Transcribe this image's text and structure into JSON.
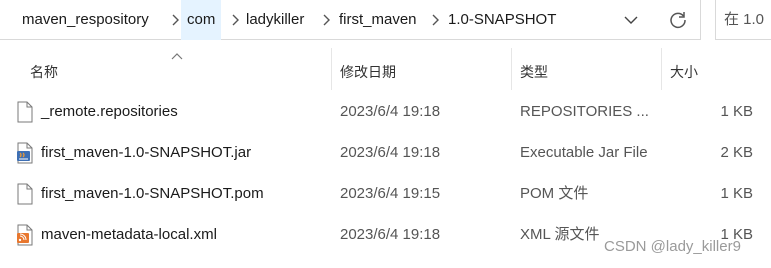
{
  "address_bar": {
    "breadcrumbs": [
      "maven_respository",
      "com",
      "ladykiller",
      "first_maven",
      "1.0-SNAPSHOT"
    ]
  },
  "search": {
    "placeholder": "在 1.0"
  },
  "columns": {
    "name": "名称",
    "date": "修改日期",
    "type": "类型",
    "size": "大小"
  },
  "files": [
    {
      "name": "_remote.repositories",
      "date": "2023/6/4 19:18",
      "type": "REPOSITORIES ...",
      "size": "1 KB",
      "icon": "file-icon"
    },
    {
      "name": "first_maven-1.0-SNAPSHOT.jar",
      "date": "2023/6/4 19:18",
      "type": "Executable Jar File",
      "size": "2 KB",
      "icon": "jar-file-icon"
    },
    {
      "name": "first_maven-1.0-SNAPSHOT.pom",
      "date": "2023/6/4 19:15",
      "type": "POM 文件",
      "size": "1 KB",
      "icon": "file-icon"
    },
    {
      "name": "maven-metadata-local.xml",
      "date": "2023/6/4 19:18",
      "type": "XML 源文件",
      "size": "1 KB",
      "icon": "xml-file-icon"
    }
  ],
  "watermark": "CSDN @lady_killer9"
}
